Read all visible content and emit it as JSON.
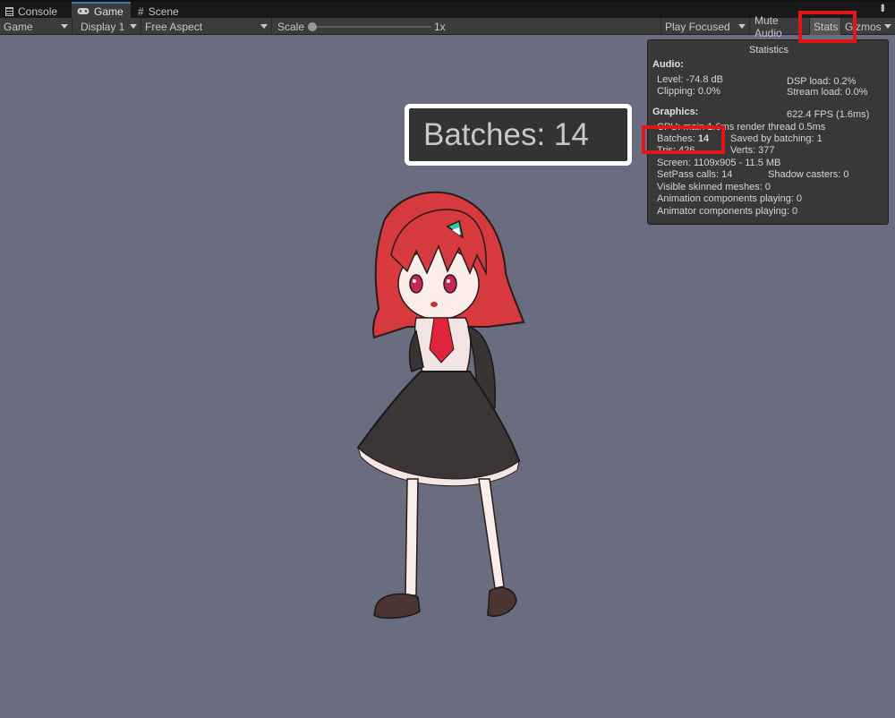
{
  "tabs": [
    {
      "label": "Console",
      "icon": "console-icon"
    },
    {
      "label": "Game",
      "icon": "gamepad-icon"
    },
    {
      "label": "Scene",
      "icon": "scene-grid-icon"
    }
  ],
  "toolbar": {
    "view": "Game",
    "display": "Display 1",
    "aspect": "Free Aspect",
    "scale_label": "Scale",
    "scale_value": "1x",
    "play_mode": "Play Focused",
    "mute_audio": "Mute Audio",
    "stats": "Stats",
    "gizmos": "Gizmos"
  },
  "callout": {
    "text": "Batches: 14"
  },
  "statistics": {
    "title": "Statistics",
    "audio_heading": "Audio:",
    "level": "Level: -74.8 dB",
    "dsp_load": "DSP load: 0.2%",
    "clipping": "Clipping: 0.0%",
    "stream_load": "Stream load: 0.0%",
    "graphics_heading": "Graphics:",
    "fps": "622.4 FPS (1.6ms)",
    "cpu": "CPU: main 1.6ms  render thread 0.5ms",
    "batches_label": "Batches:",
    "batches_value": "14",
    "saved_by_batching": "Saved by batching: 1",
    "tris": "Tris: 426",
    "verts": "Verts: 377",
    "screen": "Screen: 1109x905 - 11.5 MB",
    "setpass": "SetPass calls: 14",
    "shadow_casters": "Shadow casters: 0",
    "skinned_meshes": "Visible skinned meshes: 0",
    "animation_components": "Animation components playing: 0",
    "animator_components": "Animator components playing: 0"
  },
  "colors": {
    "viewport_bg": "#6a6d80",
    "toolbar_bg": "#3c3c3c",
    "highlight_red": "#e2151b",
    "hair": "#d63a3e"
  }
}
